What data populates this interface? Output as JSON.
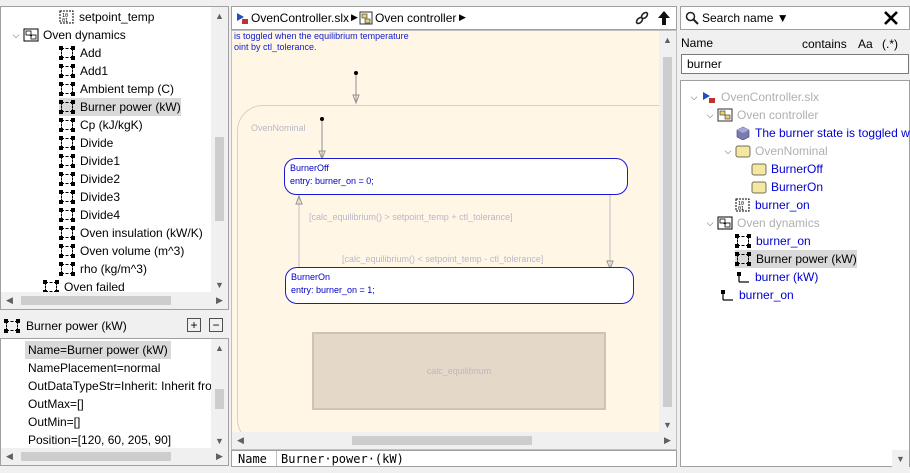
{
  "left_tree": {
    "items": [
      {
        "label": "setpoint_temp",
        "icon": "constant-block-icon",
        "indent": 58
      },
      {
        "label": "Oven dynamics",
        "icon": "subsystem-icon",
        "indent": 22,
        "caret": "expanded"
      },
      {
        "label": "Add",
        "icon": "block-icon",
        "indent": 58
      },
      {
        "label": "Add1",
        "icon": "block-icon",
        "indent": 58
      },
      {
        "label": "Ambient temp (C)",
        "icon": "block-icon",
        "indent": 58
      },
      {
        "label": "Burner power (kW)",
        "icon": "block-icon",
        "indent": 58,
        "selected": true
      },
      {
        "label": "Cp (kJ/kgK)",
        "icon": "block-icon",
        "indent": 58
      },
      {
        "label": "Divide",
        "icon": "block-icon",
        "indent": 58
      },
      {
        "label": "Divide1",
        "icon": "block-icon",
        "indent": 58
      },
      {
        "label": "Divide2",
        "icon": "block-icon",
        "indent": 58
      },
      {
        "label": "Divide3",
        "icon": "block-icon",
        "indent": 58
      },
      {
        "label": "Divide4",
        "icon": "block-icon",
        "indent": 58
      },
      {
        "label": "Oven insulation (kW/K)",
        "icon": "block-icon",
        "indent": 58
      },
      {
        "label": "Oven volume (m^3)",
        "icon": "block-icon",
        "indent": 58
      },
      {
        "label": "rho (kg/m^3)",
        "icon": "block-icon",
        "indent": 58
      },
      {
        "label": "Oven failed",
        "icon": "block-icon",
        "indent": 42
      }
    ]
  },
  "props": {
    "title": "Burner power (kW)",
    "add_label": "+",
    "remove_label": "−",
    "items": [
      {
        "text": "Name=Burner power (kW)",
        "selected": true
      },
      {
        "text": "NamePlacement=normal"
      },
      {
        "text": "OutDataTypeStr=Inherit: Inherit fro"
      },
      {
        "text": "OutMax=[]"
      },
      {
        "text": "OutMin=[]"
      },
      {
        "text": "Position=[120, 60, 205, 90]"
      }
    ]
  },
  "breadcrumb": {
    "items": [
      "OvenController.slx",
      "Oven controller"
    ],
    "link_icon": "link-icon",
    "up_icon": "arrow-up-icon"
  },
  "canvas": {
    "note_line1": "is toggled when the equilibrium temperature",
    "note_line2": "oint by ctl_tolerance.",
    "oven_nominal": "OvenNominal",
    "burner_off": {
      "name": "BurnerOff",
      "entry": "entry: burner_on = 0;"
    },
    "burner_on": {
      "name": "BurnerOn",
      "entry": "entry: burner_on = 1;"
    },
    "transition_up": "[calc_equilibrium() > setpoint_temp + ctl_tolerance]",
    "transition_down": "[calc_equilibrium() < setpoint_temp - ctl_tolerance]",
    "calc_box": "calc_equilibrium"
  },
  "name_bar": {
    "label": "Name",
    "value": "Burner·power·(kW)"
  },
  "search": {
    "mode_label": "Search name ▼",
    "close_icon": "close-icon",
    "column_name": "Name",
    "match_mode": "contains",
    "case_toggle": "Aa",
    "regex_toggle": "(.*)",
    "query": "burner"
  },
  "results": {
    "items": [
      {
        "label": "OvenController.slx",
        "style": "gray",
        "icon": "model-icon",
        "indent": 20,
        "caret": "expanded"
      },
      {
        "label": "Oven controller",
        "style": "gray",
        "icon": "chart-icon",
        "indent": 36,
        "caret": "expanded"
      },
      {
        "label": "The burner state is toggled w",
        "style": "blue",
        "icon": "annotation-icon",
        "indent": 54
      },
      {
        "label": "OvenNominal",
        "style": "gray",
        "icon": "state-icon",
        "indent": 54,
        "caret": "expanded"
      },
      {
        "label": "BurnerOff",
        "style": "blue",
        "icon": "state-icon",
        "indent": 70
      },
      {
        "label": "BurnerOn",
        "style": "blue",
        "icon": "state-icon",
        "indent": 70
      },
      {
        "label": "burner_on",
        "style": "blue",
        "icon": "data-icon",
        "indent": 54
      },
      {
        "label": "Oven dynamics",
        "style": "gray",
        "icon": "subsystem-icon",
        "indent": 36,
        "caret": "expanded"
      },
      {
        "label": "burner_on",
        "style": "blue",
        "icon": "block-icon",
        "indent": 54
      },
      {
        "label": "Burner power (kW)",
        "style": "black",
        "icon": "block-icon",
        "indent": 54,
        "selected": true
      },
      {
        "label": "burner (kW)",
        "style": "blue",
        "icon": "port-icon",
        "indent": 54
      },
      {
        "label": "burner_on",
        "style": "blue",
        "icon": "port-icon",
        "indent": 38
      }
    ]
  }
}
